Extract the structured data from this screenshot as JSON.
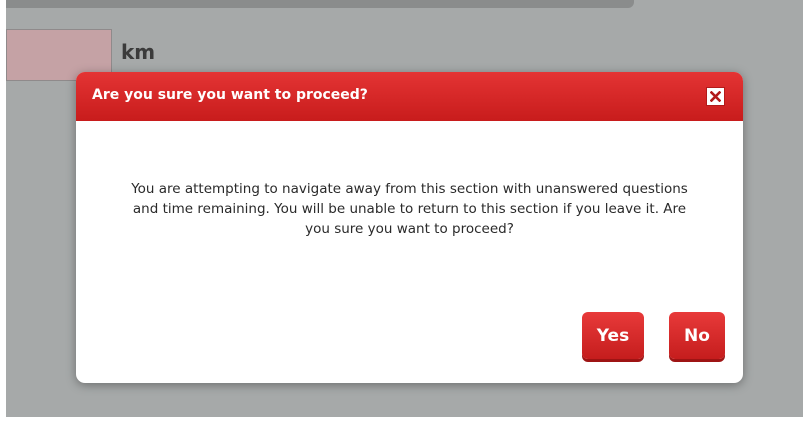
{
  "background": {
    "unit_label": "km",
    "answer_value": ""
  },
  "dialog": {
    "title": "Are you sure you want to proceed?",
    "message": "You are attempting to navigate away from this section with unanswered questions and time remaining. You will be unable to return to this section if you leave it.  Are you sure you want to proceed?",
    "close_icon": "close-icon",
    "yes_label": "Yes",
    "no_label": "No",
    "accent_color": "#d62828"
  }
}
